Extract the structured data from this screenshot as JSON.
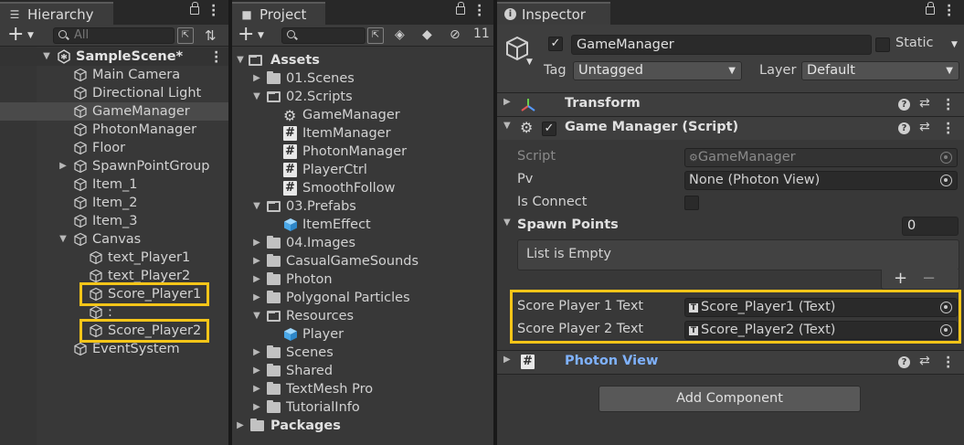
{
  "hierarchy": {
    "tab_title": "Hierarchy",
    "search_placeholder": "All",
    "scene": "SampleScene*",
    "items": [
      "Main Camera",
      "Directional Light",
      "GameManager",
      "PhotonManager",
      "Floor",
      "SpawnPointGroup",
      "Item_1",
      "Item_2",
      "Item_3",
      "Canvas",
      "text_Player1",
      "text_Player2",
      "Score_Player1",
      ":",
      "Score_Player2",
      "EventSystem"
    ]
  },
  "project": {
    "tab_title": "Project",
    "hidden_count": "11",
    "items": [
      "Assets",
      "01.Scenes",
      "02.Scripts",
      "GameManager",
      "ItemManager",
      "PhotonManager",
      "PlayerCtrl",
      "SmoothFollow",
      "03.Prefabs",
      "ItemEffect",
      "04.Images",
      "CasualGameSounds",
      "Photon",
      "Polygonal Particles",
      "Resources",
      "Player",
      "Scenes",
      "Shared",
      "TextMesh Pro",
      "TutorialInfo",
      "Packages"
    ]
  },
  "inspector": {
    "tab_title": "Inspector",
    "object_name": "GameManager",
    "static_label": "Static",
    "tag_label": "Tag",
    "tag_value": "Untagged",
    "layer_label": "Layer",
    "layer_value": "Default",
    "transform_title": "Transform",
    "script_component_title": "Game Manager (Script)",
    "script_label": "Script",
    "script_value": "GameManager",
    "pv_label": "Pv",
    "pv_value": "None (Photon View)",
    "is_connect_label": "Is Connect",
    "spawn_points_label": "Spawn Points",
    "spawn_points_count": "0",
    "list_empty": "List is Empty",
    "list_plus": "+",
    "list_minus": "−",
    "score1_label": "Score Player 1 Text",
    "score1_value": "Score_Player1 (Text)",
    "score2_label": "Score Player 2 Text",
    "score2_value": "Score_Player2 (Text)",
    "photon_view_title": "Photon View",
    "add_component": "Add Component"
  },
  "colors": {
    "highlight": "#f5c518",
    "photon_view_title": "#7fb2ff"
  }
}
